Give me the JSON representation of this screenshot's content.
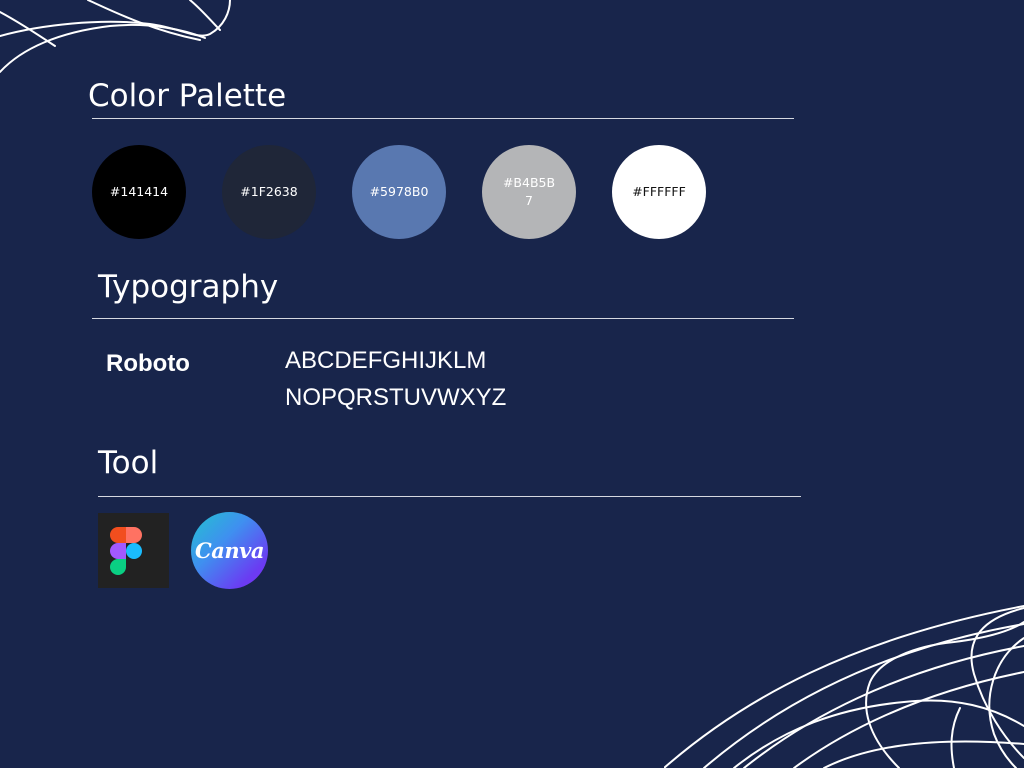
{
  "sections": {
    "color_palette": {
      "title": "Color Palette"
    },
    "typography": {
      "title": "Typography"
    },
    "tool": {
      "title": "Tool"
    }
  },
  "palette": [
    {
      "hex": "#141414",
      "label": "#141414",
      "label_line2": "",
      "text_color": "#ffffff"
    },
    {
      "hex": "#1F2638",
      "label": "#1F2638",
      "label_line2": "",
      "text_color": "#ffffff"
    },
    {
      "hex": "#5978B0",
      "label": "#5978B0",
      "label_line2": "",
      "text_color": "#ffffff"
    },
    {
      "hex": "#B4B5B7",
      "label": "#B4B5B",
      "label_line2": "7",
      "text_color": "#ffffff"
    },
    {
      "hex": "#FFFFFF",
      "label": "#FFFFFF",
      "label_line2": "",
      "text_color": "#141414"
    }
  ],
  "typography": {
    "font_name": "Roboto",
    "sample_line1": "ABCDEFGHIJKLM",
    "sample_line2": "NOPQRSTUVWXYZ"
  },
  "tools": [
    {
      "icon": "figma-logo"
    },
    {
      "icon": "canva-logo",
      "wordmark": "Canva"
    }
  ],
  "theme": {
    "background": "#18254B",
    "text": "#FFFFFF",
    "rule": "#D5D8E0"
  }
}
